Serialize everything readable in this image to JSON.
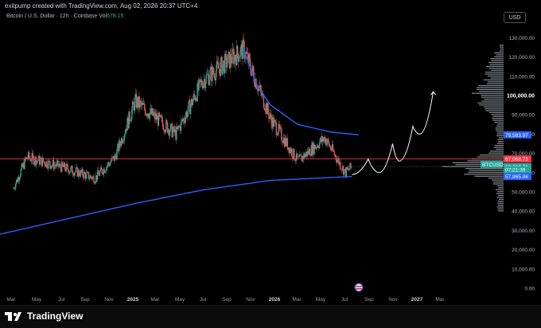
{
  "header": {
    "caption": "exitpump created with TradingView.com, Aug 02, 2026 20:37 UTC+4",
    "symbol": "Bitcoin / U.S. Dollar · 12h · Coinbase",
    "vol_label": "Vol",
    "vol_value": "678.15"
  },
  "currency_button": "USD",
  "colors": {
    "background": "#000000",
    "up_candle": "#26a69a",
    "down_candle": "#ef5350",
    "ma_line": "#2962ff",
    "price_line": "#f23645",
    "projection": "#ffffff",
    "volume_profile": "#b2b5be"
  },
  "chart_data": {
    "type": "candlestick",
    "y_axis_ticks": [
      "130,000.00",
      "120,000.00",
      "110,000.00",
      "100,000.00",
      "90,000.00",
      "80,000.00",
      "70,000.00",
      "60,000.00",
      "50,000.00",
      "40,000.00",
      "30,000.00",
      "20,000.00",
      "10,000.00",
      "0.00"
    ],
    "y_axis_bold_tick": "100,000.00",
    "x_axis_ticks": [
      "Mar",
      "May",
      "Jul",
      "Sep",
      "Nov",
      "2025",
      "Mar",
      "May",
      "Jul",
      "Sep",
      "Nov",
      "2026",
      "Mar",
      "May",
      "Jul",
      "Sep",
      "Nov",
      "2027",
      "Mar"
    ],
    "price_tags": [
      {
        "label": "79,583.97",
        "color": "#2962ff",
        "text_color": "#ffffff"
      },
      {
        "label": "67,068.73",
        "color": "#f23645",
        "text_color": "#ffffff"
      },
      {
        "label": "BTCUSD",
        "color": "#26a69a",
        "text_color": "#ffffff"
      },
      {
        "label": "63,090.73",
        "color": "#26a69a",
        "text_color": "#ffffff"
      },
      {
        "label": "07:21:39",
        "color": "#26a69a",
        "text_color": "#ffffff"
      },
      {
        "label": "57,965.06",
        "color": "#2962ff",
        "text_color": "#ffffff"
      }
    ],
    "series": [
      {
        "kind": "price",
        "approx_path": [
          [
            2024.1,
            52000
          ],
          [
            2024.2,
            68000
          ],
          [
            2024.5,
            62000
          ],
          [
            2024.7,
            57000
          ],
          [
            2024.85,
            68000
          ],
          [
            2025.0,
            97000
          ],
          [
            2025.3,
            80000
          ],
          [
            2025.5,
            108000
          ],
          [
            2025.8,
            124000
          ],
          [
            2026.0,
            88000
          ],
          [
            2026.2,
            66000
          ],
          [
            2026.4,
            78000
          ],
          [
            2026.55,
            60000
          ],
          [
            2026.6,
            63090
          ]
        ]
      },
      {
        "kind": "moving-average-short",
        "approx_path": [
          [
            2025.8,
            124000
          ],
          [
            2025.9,
            105000
          ],
          [
            2026.0,
            95000
          ],
          [
            2026.2,
            85000
          ],
          [
            2026.45,
            81000
          ],
          [
            2026.65,
            79584
          ]
        ]
      },
      {
        "kind": "moving-average-long",
        "approx_path": [
          [
            2024.0,
            28000
          ],
          [
            2024.5,
            36000
          ],
          [
            2025.0,
            44000
          ],
          [
            2025.5,
            51000
          ],
          [
            2026.0,
            56000
          ],
          [
            2026.6,
            57965
          ]
        ]
      },
      {
        "kind": "projection",
        "approx_path": [
          [
            2026.6,
            59000
          ],
          [
            2026.72,
            67000
          ],
          [
            2026.8,
            60000
          ],
          [
            2026.9,
            75000
          ],
          [
            2026.95,
            66000
          ],
          [
            2027.05,
            84000
          ],
          [
            2027.1,
            80000
          ],
          [
            2027.2,
            102000
          ]
        ]
      }
    ],
    "horizontal_line_price": 67068.73
  }
}
